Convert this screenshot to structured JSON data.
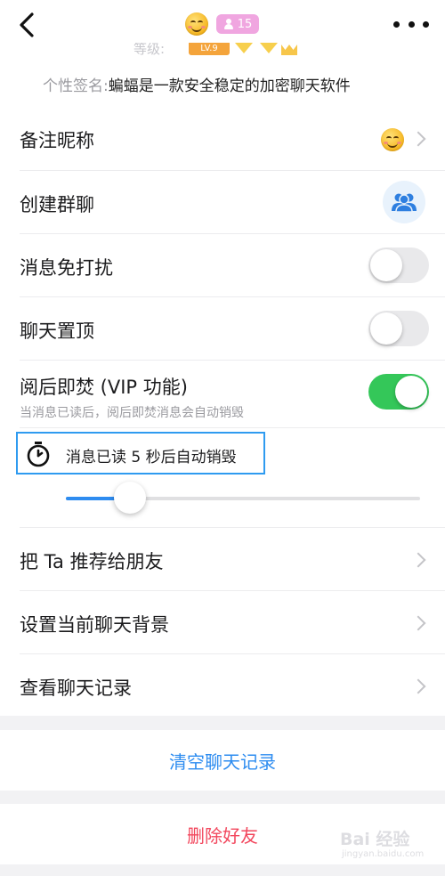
{
  "header": {
    "member_count": "15",
    "level_label": "等级:",
    "level_badge": "LV.9",
    "signature_label": "个性签名:",
    "signature_text": "蝙蝠是一款安全稳定的加密聊天软件"
  },
  "settings": {
    "remark": {
      "label": "备注昵称"
    },
    "create_group": {
      "label": "创建群聊"
    },
    "mute": {
      "label": "消息免打扰",
      "on": false
    },
    "pin": {
      "label": "聊天置顶",
      "on": false
    },
    "burn": {
      "label": "阅后即焚 (VIP 功能)",
      "desc": "当消息已读后，阅后即焚消息会自动销毁",
      "on": true
    },
    "burn_timer": {
      "text": "消息已读 5 秒后自动销毁",
      "slider_fraction": 0.18
    },
    "recommend": {
      "label": "把 Ta 推荐给朋友"
    },
    "background": {
      "label": "设置当前聊天背景"
    },
    "history": {
      "label": "查看聊天记录"
    }
  },
  "actions": {
    "clear": "清空聊天记录",
    "delete": "删除好友"
  },
  "watermark": {
    "text": "Bai 经验",
    "sub": "jingyan.baidu.com"
  },
  "colors": {
    "accent_blue": "#2d8cf0",
    "toggle_on": "#34c759",
    "delete_red": "#f2475d",
    "member_badge": "#f0a6e0",
    "level_badge": "#f4a43b"
  }
}
